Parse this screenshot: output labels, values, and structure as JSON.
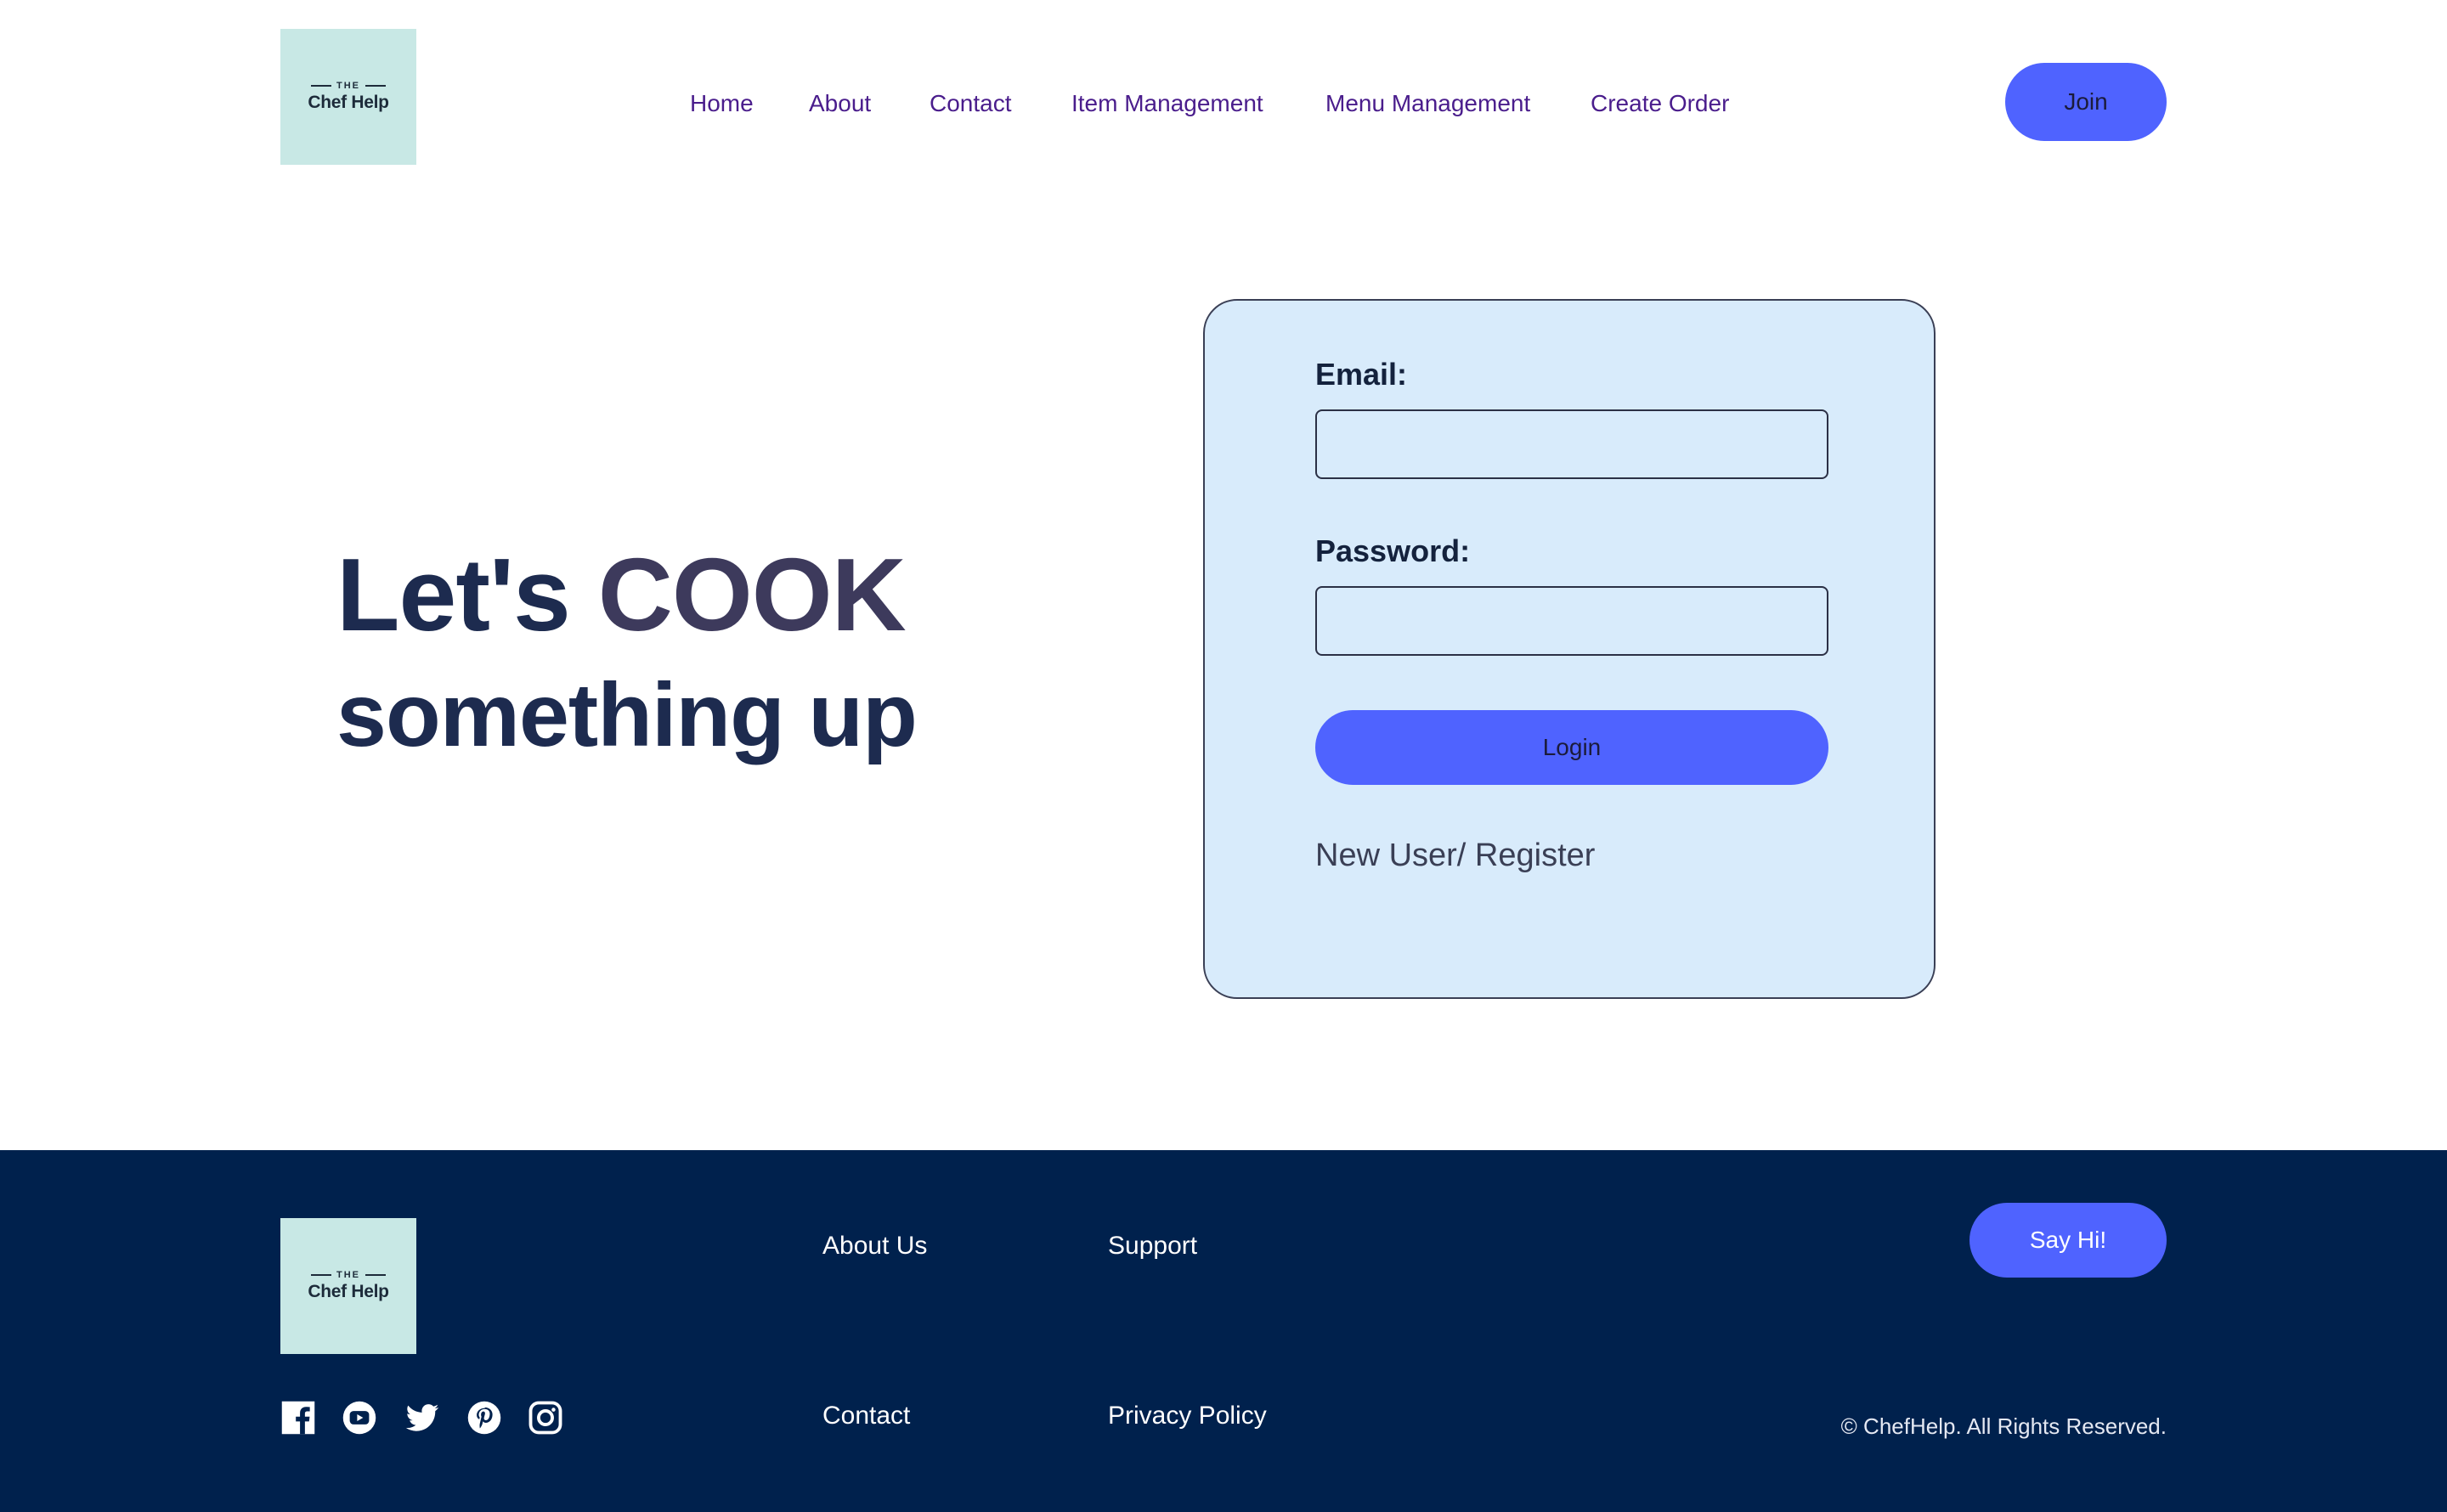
{
  "header": {
    "logo_top": "THE",
    "logo_name": "Chef Help",
    "nav": [
      {
        "label": "Home"
      },
      {
        "label": "About"
      },
      {
        "label": "Contact"
      },
      {
        "label": "Item Management"
      },
      {
        "label": "Menu Management"
      },
      {
        "label": "Create Order"
      }
    ],
    "join_label": "Join"
  },
  "hero": {
    "line1_prefix": "Let's",
    "line1_highlight": "COOK",
    "line2": "something up"
  },
  "login": {
    "email_label": "Email:",
    "email_value": "",
    "password_label": "Password:",
    "password_value": "",
    "login_button": "Login",
    "register_link": "New User/ Register"
  },
  "footer": {
    "logo_top": "THE",
    "logo_name": "Chef Help",
    "links": [
      {
        "label": "About Us"
      },
      {
        "label": "Support"
      },
      {
        "label": "Contact"
      },
      {
        "label": "Privacy Policy"
      }
    ],
    "say_hi_label": "Say Hi!",
    "social_icons": [
      "facebook-icon",
      "youtube-icon",
      "twitter-icon",
      "pinterest-icon",
      "instagram-icon"
    ],
    "copyright": "© ChefHelp. All Rights Reserved."
  },
  "colors": {
    "accent": "#4f63ff",
    "nav_text": "#4a1d8c",
    "logo_bg": "#c8e8e5",
    "card_bg": "#d8ebfb",
    "footer_bg": "#00214d",
    "hero_text": "#1d2b4f"
  }
}
